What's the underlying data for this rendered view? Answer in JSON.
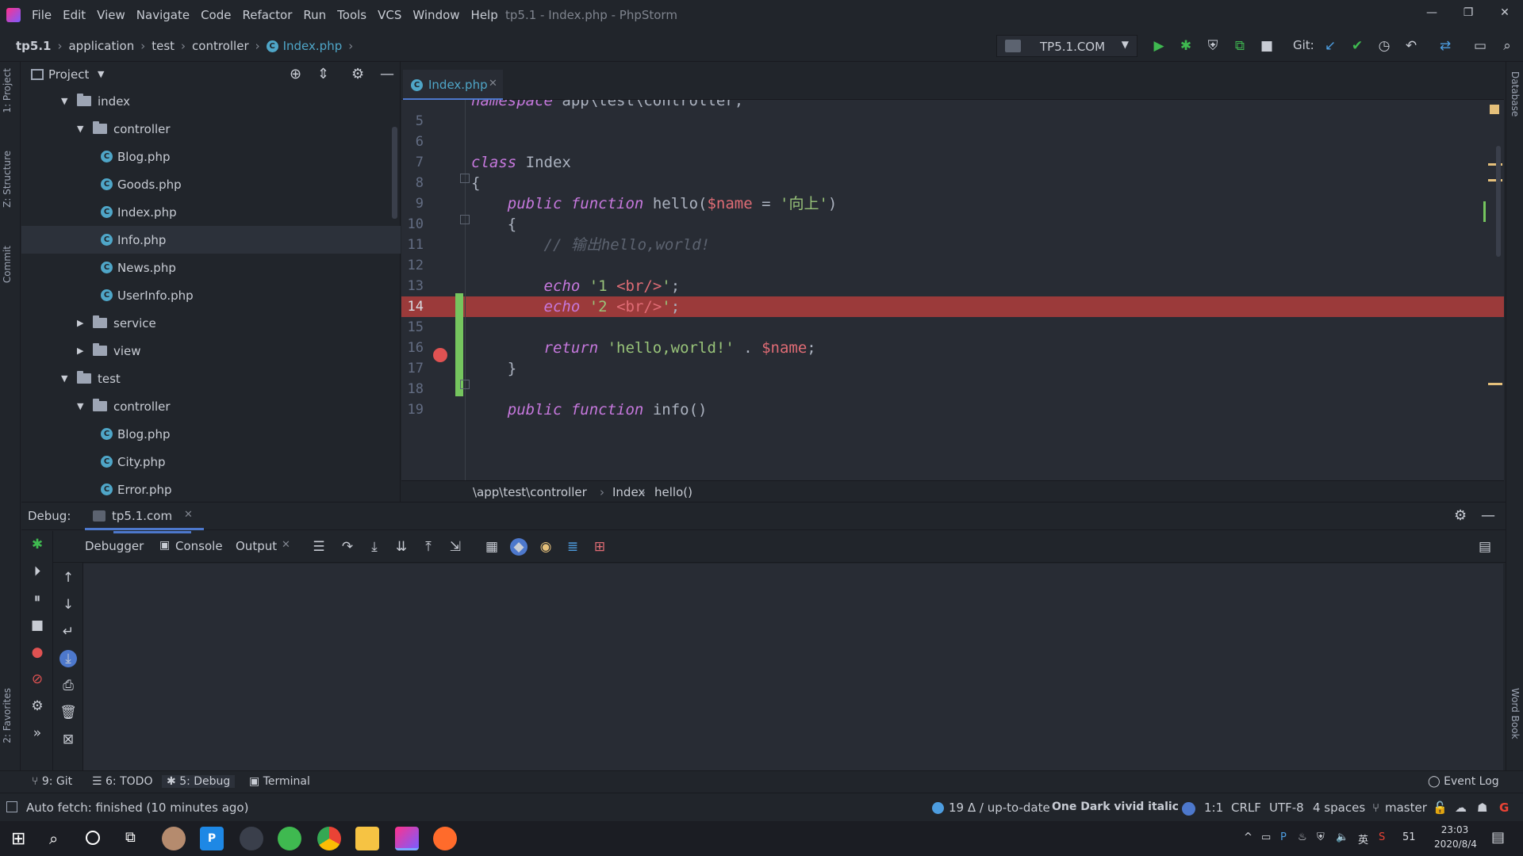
{
  "window": {
    "title": "tp5.1 - Index.php - PhpStorm",
    "menu": [
      "File",
      "Edit",
      "View",
      "Navigate",
      "Code",
      "Refactor",
      "Run",
      "Tools",
      "VCS",
      "Window",
      "Help"
    ],
    "controls": [
      "—",
      "❐",
      "✕"
    ]
  },
  "navbar": {
    "breadcrumb": [
      "tp5.1",
      "application",
      "test",
      "controller",
      "Index.php"
    ],
    "run_config": "TP5.1.COM",
    "git_label": "Git:"
  },
  "left_strip": [
    "1: Project",
    "Z: Structure",
    "Commit",
    "2: Favorites"
  ],
  "right_strip": [
    "Database",
    "Word Book"
  ],
  "project": {
    "title": "Project",
    "tree": [
      {
        "label": "index",
        "kind": "folder",
        "depth": 0,
        "expanded": true
      },
      {
        "label": "controller",
        "kind": "folder",
        "depth": 1,
        "expanded": true
      },
      {
        "label": "Blog.php",
        "kind": "php",
        "depth": 2
      },
      {
        "label": "Goods.php",
        "kind": "php",
        "depth": 2
      },
      {
        "label": "Index.php",
        "kind": "php",
        "depth": 2
      },
      {
        "label": "Info.php",
        "kind": "php",
        "depth": 2,
        "selected": true
      },
      {
        "label": "News.php",
        "kind": "php",
        "depth": 2
      },
      {
        "label": "UserInfo.php",
        "kind": "php",
        "depth": 2
      },
      {
        "label": "service",
        "kind": "folder",
        "depth": 1,
        "expanded": false
      },
      {
        "label": "view",
        "kind": "folder",
        "depth": 1,
        "expanded": false
      },
      {
        "label": "test",
        "kind": "folder",
        "depth": 0,
        "expanded": true
      },
      {
        "label": "controller",
        "kind": "folder",
        "depth": 1,
        "expanded": true
      },
      {
        "label": "Blog.php",
        "kind": "php",
        "depth": 2
      },
      {
        "label": "City.php",
        "kind": "php",
        "depth": 2
      },
      {
        "label": "Error.php",
        "kind": "php",
        "depth": 2
      }
    ]
  },
  "editor": {
    "tab": "Index.php",
    "lines": [
      {
        "n": "",
        "html": "<span class=\"kw\">namespace</span> app\\test\\controller;"
      },
      {
        "n": "5",
        "html": ""
      },
      {
        "n": "6",
        "html": ""
      },
      {
        "n": "7",
        "html": "<span class=\"kw\">class</span> <span class=\"cls\">Index</span>"
      },
      {
        "n": "8",
        "html": "{"
      },
      {
        "n": "9",
        "html": "    <span class=\"kw\">public function</span> <span class=\"fn\">hello</span>(<span class=\"var\">$name</span> = <span class=\"str\">'向上'</span>)"
      },
      {
        "n": "10",
        "html": "    {"
      },
      {
        "n": "11",
        "html": "        <span class=\"cmt\">// 输出hello,world!</span>"
      },
      {
        "n": "12",
        "html": ""
      },
      {
        "n": "13",
        "html": "        <span class=\"kw\">echo</span> <span class=\"str\">'1 </span><span class=\"var\">&lt;br/&gt;</span><span class=\"str\">'</span>;"
      },
      {
        "n": "14",
        "html": "        <span class=\"kw\">echo</span> <span class=\"str\">'2 </span><span class=\"var\">&lt;br/&gt;</span><span class=\"str\">'</span>;",
        "breakpoint": true
      },
      {
        "n": "15",
        "html": ""
      },
      {
        "n": "16",
        "html": "        <span class=\"kw\">return</span> <span class=\"str\">'hello,world!'</span> . <span class=\"var\">$name</span>;"
      },
      {
        "n": "17",
        "html": "    }"
      },
      {
        "n": "18",
        "html": ""
      },
      {
        "n": "19",
        "html": "    <span class=\"kw\">public function</span> <span class=\"fn\">info</span>()"
      }
    ],
    "breadcrumb": [
      "\\app\\test\\controller",
      "Index",
      "hello()"
    ]
  },
  "debug": {
    "label": "Debug:",
    "session": "tp5.1.com",
    "tabs": [
      "Debugger",
      "Console",
      "Output"
    ]
  },
  "bottom_tools": [
    "9: Git",
    "6: TODO",
    "5: Debug",
    "Terminal"
  ],
  "event_log": "Event Log",
  "status": {
    "message": "Auto fetch: finished (10 minutes ago)",
    "vcs": "19 Δ / up-to-date",
    "theme": "One Dark vivid italic",
    "position": "1:1",
    "line_sep": "CRLF",
    "encoding": "UTF-8",
    "indent": "4 spaces",
    "branch": "master"
  },
  "taskbar": {
    "time": "23:03",
    "date": "2020/8/4",
    "lang": "英",
    "badge": "51"
  },
  "colors": {
    "accent": "#4d78cc",
    "breakpoint_line": "#9b3a3a",
    "breakpoint_dot": "#e05252",
    "change_bar": "#75c55e",
    "run_green": "#3fb950"
  }
}
